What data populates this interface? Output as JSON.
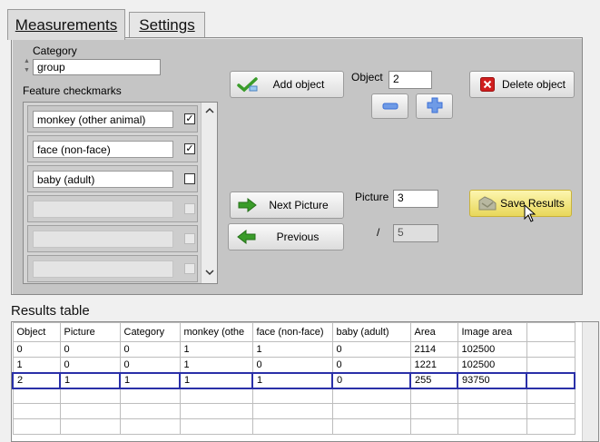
{
  "tabs": [
    {
      "label": "Measurements",
      "active": true
    },
    {
      "label": "Settings",
      "active": false
    }
  ],
  "category": {
    "label": "Category",
    "value": "group"
  },
  "features": {
    "label": "Feature checkmarks",
    "items": [
      {
        "text": "monkey (other animal)",
        "checked": true
      },
      {
        "text": "face (non-face)",
        "checked": true
      },
      {
        "text": "baby (adult)",
        "checked": false
      },
      {
        "text": "",
        "checked": false
      },
      {
        "text": "",
        "checked": false
      },
      {
        "text": "",
        "checked": false
      }
    ]
  },
  "buttons": {
    "add_object": "Add object",
    "delete_object": "Delete object",
    "next_picture": "Next Picture",
    "previous": "Previous",
    "save_results": "Save Results"
  },
  "object": {
    "label": "Object",
    "value": "2"
  },
  "picture": {
    "label": "Picture",
    "value": "3",
    "separator": "/",
    "total": "5"
  },
  "results": {
    "title": "Results table",
    "columns": [
      "Object",
      "Picture",
      "Category",
      "monkey (othe",
      "face (non-face)",
      "baby (adult)",
      "Area",
      "Image area",
      ""
    ],
    "rows": [
      [
        "0",
        "0",
        "0",
        "1",
        "1",
        "0",
        "2114",
        "102500",
        ""
      ],
      [
        "1",
        "0",
        "0",
        "1",
        "0",
        "0",
        "1221",
        "102500",
        ""
      ],
      [
        "2",
        "1",
        "1",
        "1",
        "1",
        "0",
        "255",
        "93750",
        ""
      ],
      [
        "",
        "",
        "",
        "",
        "",
        "",
        "",
        "",
        ""
      ],
      [
        "",
        "",
        "",
        "",
        "",
        "",
        "",
        "",
        ""
      ],
      [
        "",
        "",
        "",
        "",
        "",
        "",
        "",
        "",
        ""
      ]
    ],
    "selected_row": 2
  },
  "colors": {
    "accent_green": "#3a9c2a",
    "accent_blue": "#3b6fd6",
    "delete_red": "#d01e1e",
    "selection": "#2a30a8"
  }
}
